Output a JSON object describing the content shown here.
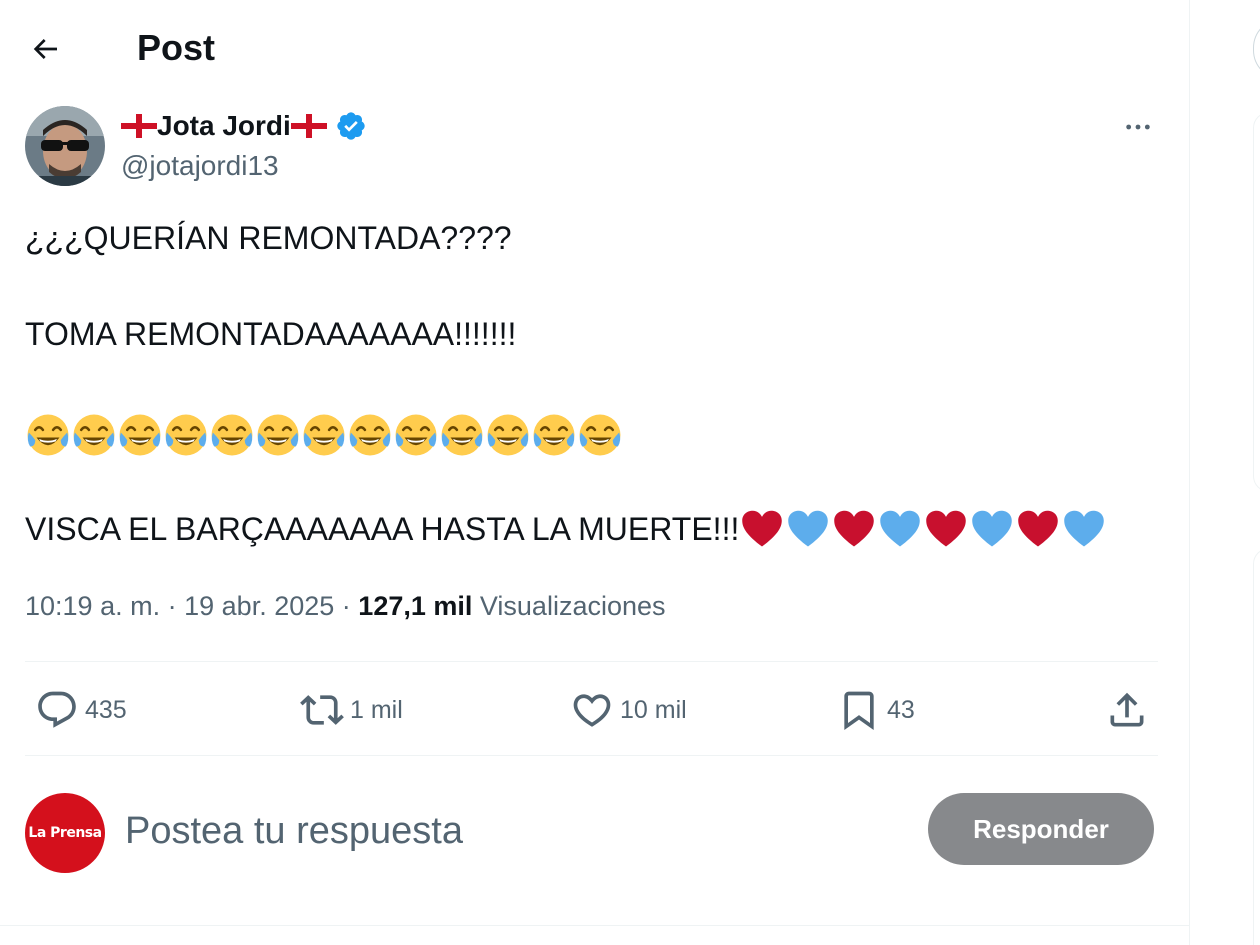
{
  "header": {
    "title": "Post"
  },
  "post": {
    "author_name": "Jota Jordi",
    "handle": "@jotajordi13",
    "lines": [
      "¿¿¿QUERÍAN REMONTADA????",
      "TOMA REMONTADAAAAAAA!!!!!!!",
      "VISCA EL BARÇAAAAAAA HASTA LA MUERTE!!!"
    ],
    "emoji_laugh_count": 13,
    "hearts_pattern": [
      "red",
      "blue",
      "red",
      "blue",
      "red",
      "blue",
      "red",
      "blue"
    ],
    "time": "10:19 a. m.",
    "date": "19 abr. 2025",
    "separator": "·",
    "views_count": "127,1 mil",
    "views_label": "Visualizaciones"
  },
  "actions": {
    "replies": "435",
    "reposts": "1 mil",
    "likes": "10 mil",
    "bookmarks": "43"
  },
  "reply": {
    "avatar_text": "La Prensa",
    "placeholder": "Postea tu respuesta",
    "button_label": "Responder"
  },
  "colors": {
    "accent": "#1d9bf0",
    "secondary_text": "#536471",
    "heart_red": "#c8102e",
    "heart_blue": "#5dadec",
    "button_disabled": "#87898c",
    "reply_avatar": "#d4101c"
  },
  "icons": {
    "back": "arrow-left-icon",
    "verified": "verified-badge-icon",
    "more": "more-horizontal-icon",
    "reply": "speech-bubble-icon",
    "repost": "repost-arrows-icon",
    "like": "heart-outline-icon",
    "bookmark": "bookmark-icon",
    "share": "share-upload-icon"
  }
}
